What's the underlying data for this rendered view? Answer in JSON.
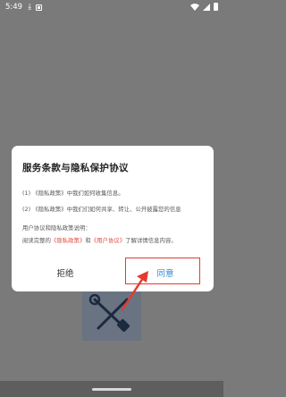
{
  "status_bar": {
    "time": "5:49",
    "icons": [
      "download-icon",
      "app-notification-icon",
      "wifi-icon",
      "signal-icon",
      "battery-icon"
    ]
  },
  "dialog": {
    "title": "服务条款与隐私保护协议",
    "lines": {
      "l1": "(1) 《隐私政策》中我们如何收集信息。",
      "l2": "(2) 《隐私政策》中我们们如何共享、转让、公开披露您的信息",
      "l3": "用户协议和隐私政策说明：",
      "l4_prefix": "阅读完整的",
      "l4_link1": "《隐私政策》",
      "l4_mid": "和",
      "l4_link2": "《用户协议》",
      "l4_suffix": "了解详情信息内容。"
    },
    "buttons": {
      "reject": "拒绝",
      "agree": "同意"
    }
  },
  "colors": {
    "overlay": "#7a7a7a",
    "link": "#e0483c",
    "agree": "#2f86d6",
    "annotation": "#e33b2f"
  }
}
